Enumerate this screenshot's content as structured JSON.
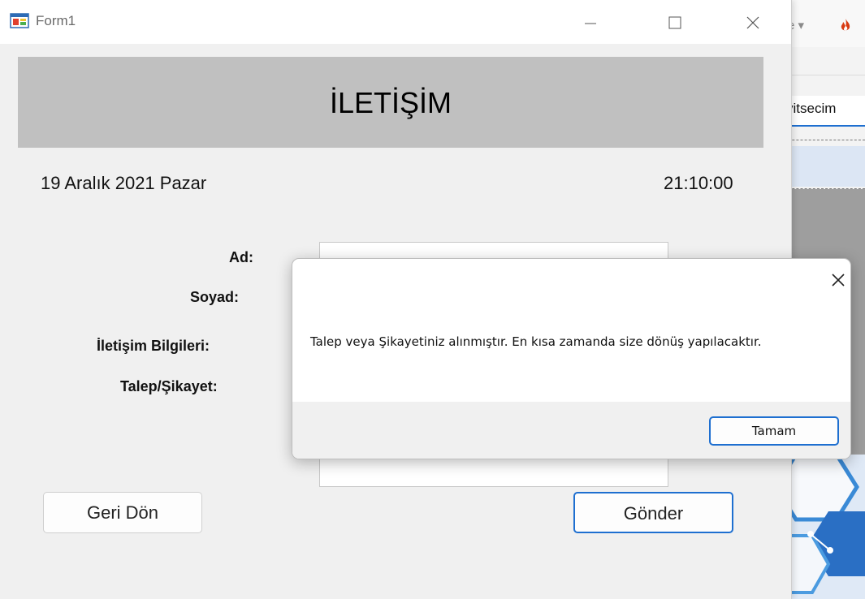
{
  "background_app": {
    "title_fragment": "e ▾",
    "flame_icon": "flame-icon",
    "tab_fragment": "yitsecim"
  },
  "window": {
    "title": "Form1",
    "icons": [
      "app-icon",
      "minimize-icon",
      "maximize-icon",
      "close-icon"
    ]
  },
  "header": {
    "title": "İLETİŞİM",
    "background": "#c0c0c0"
  },
  "datetime": {
    "date": "19 Aralık 2021 Pazar",
    "time": "21:10:00"
  },
  "form": {
    "labels": {
      "ad": "Ad:",
      "soyad": "Soyad:",
      "iletisim": "İletişim Bilgileri:",
      "talep": "Talep/Şikayet:"
    }
  },
  "buttons": {
    "geri": "Geri Dön",
    "gonder": "Gönder"
  },
  "dialog": {
    "message": "Talep veya Şikayetiniz alınmıştır. En kısa zamanda size dönüş yapılacaktır.",
    "ok_label": "Tamam",
    "accent": "#1e6fd0"
  }
}
